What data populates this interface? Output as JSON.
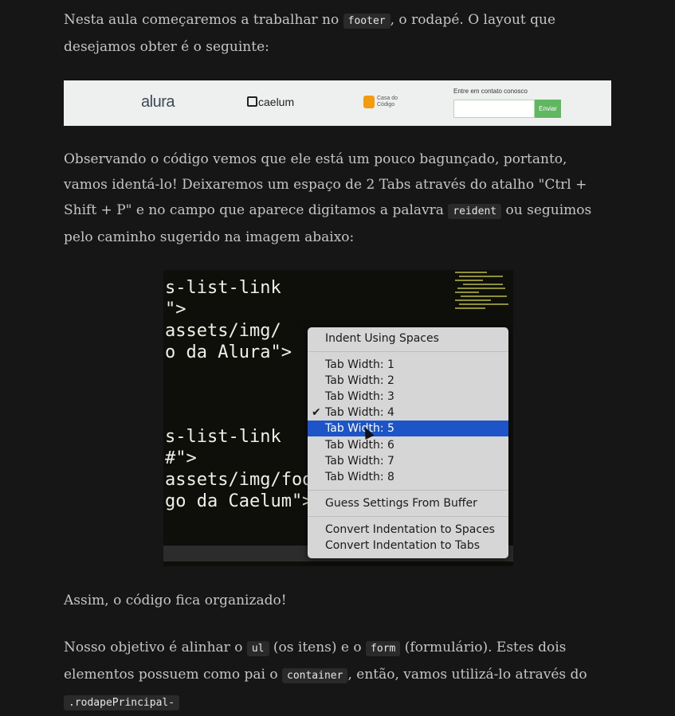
{
  "p1": {
    "a": "Nesta aula começaremos a trabalhar no ",
    "code": "footer",
    "b": ", o rodapé. O layout que desejamos obter é o seguinte:"
  },
  "banner": {
    "logo1": "alura",
    "logo2": "caelum",
    "logo3_line1": "Casa do",
    "logo3_line2": "Código",
    "contact_label": "Entre em contato conosco",
    "button": "Enviar"
  },
  "p2": {
    "a": "Observando o código vemos que ele está um pouco bagunçado, portanto, vamos identá-lo! Deixaremos um espaço de 2 Tabs através do atalho \"Ctrl + Shift + P\" e no campo que aparece digitamos a palavra ",
    "code": "reident",
    "b": " ou seguimos pelo caminho sugerido na imagem abaixo:"
  },
  "editor": {
    "lines": [
      "s-list-link",
      "\">",
      "assets/img/",
      "o da Alura\">",
      "s-list-link",
      "#\">",
      "assets/img/foo",
      "go da Caelum\">"
    ]
  },
  "menu": {
    "items": [
      "Indent Using Spaces",
      "Tab Width: 1",
      "Tab Width: 2",
      "Tab Width: 3",
      "Tab Width: 4",
      "Tab Width: 5",
      "Tab Width: 6",
      "Tab Width: 7",
      "Tab Width: 8",
      "Guess Settings From Buffer",
      "Convert Indentation to Spaces",
      "Convert Indentation to Tabs"
    ],
    "checked_item": "Tab Width: 4",
    "selected_item": "Tab Width: 5",
    "highlight_color": "#1d54c8"
  },
  "p3": "Assim, o código fica organizado!",
  "p4": {
    "a": "Nosso objetivo é alinhar o ",
    "code1": "ul",
    "b": " (os itens) e o ",
    "code2": "form",
    "c": " (formulário). Estes dois elementos possuem como pai o ",
    "code3": "container",
    "d": ", então, vamos utilizá-lo através do ",
    "code4": ".rodapePrincipal-"
  }
}
